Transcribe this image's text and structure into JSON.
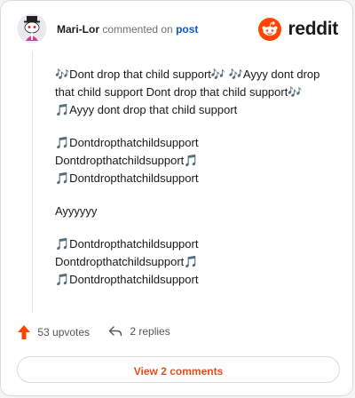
{
  "header": {
    "author": "Mari-Lor",
    "action": "commented on",
    "post_link": "post",
    "brand": "reddit"
  },
  "comment": {
    "paragraphs": [
      "🎶Dont drop that child support🎶 🎶Ayyy dont drop that child support Dont drop that child support🎶 🎵Ayyy dont drop that child support",
      "🎵Dontdropthatchildsupport Dontdropthatchildsupport🎵 🎵Dontdropthatchildsupport",
      "Ayyyyyy",
      "🎵Dontdropthatchildsupport Dontdropthatchildsupport🎵 🎵Dontdropthatchildsupport"
    ]
  },
  "footer": {
    "upvotes": "53 upvotes",
    "replies": "2 replies"
  },
  "view_comments": "View 2 comments",
  "colors": {
    "upvote": "#ff4500",
    "accent": "#e0501c",
    "link": "#0b57d0"
  }
}
